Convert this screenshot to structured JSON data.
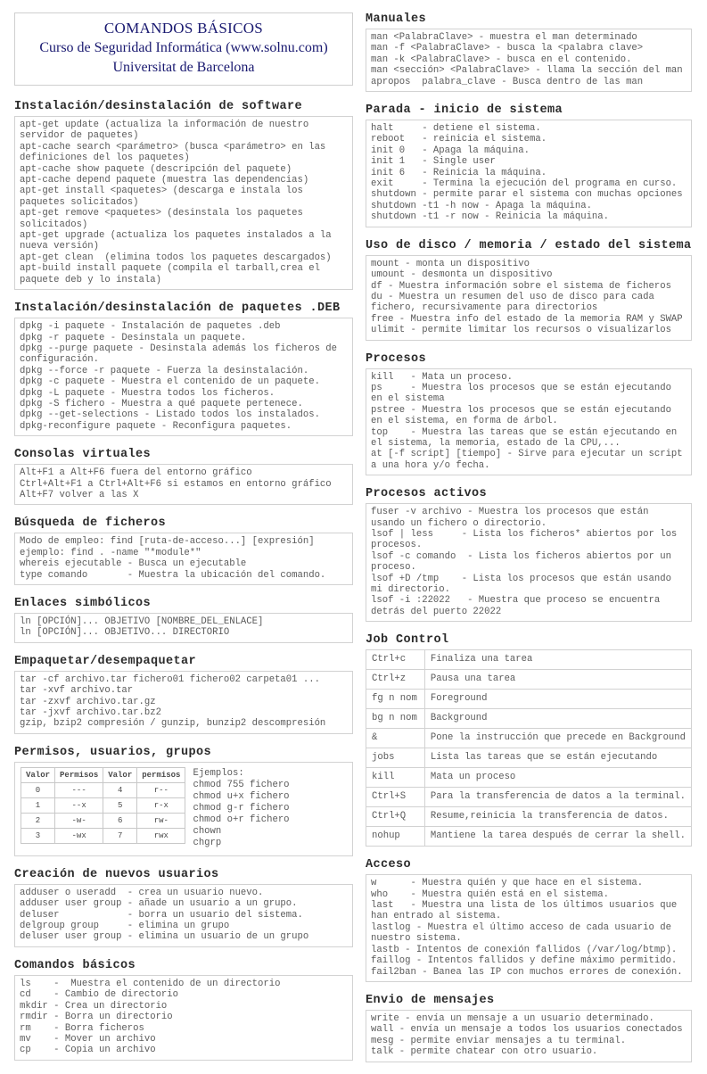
{
  "title": {
    "line1": "COMANDOS BÁSICOS",
    "line2": "Curso de Seguridad Informática (www.solnu.com)",
    "line3": "Universitat de Barcelona",
    "color": "#191970"
  },
  "left_column": [
    {
      "heading": "Instalación/desinstalación de software",
      "lines": [
        "apt-get update (actualiza la información de nuestro servidor de paquetes)",
        "apt-cache search <parámetro> (busca <parámetro> en las definiciones del los paquetes)",
        "apt-cache show paquete (descripción del paquete)",
        "apt-cache depend paquete (muestra las dependencias)",
        "apt-get install <paquetes> (descarga e instala los paquetes solicitados)",
        "apt-get remove <paquetes> (desinstala los paquetes solicitados)",
        "apt-get upgrade (actualiza los paquetes instalados a la nueva versión)",
        "apt-get clean  (elimina todos los paquetes descargados)",
        "apt-build install paquete (compila el tarball,crea el paquete deb y lo instala)"
      ]
    },
    {
      "heading": "Instalación/desinstalación de paquetes .DEB",
      "lines": [
        "dpkg -i paquete - Instalación de paquetes .deb",
        "dpkg -r paquete - Desinstala un paquete.",
        "dpkg --purge paquete - Desinstala además los ficheros de configuración.",
        "dpkg --force -r paquete - Fuerza la desinstalación.",
        "dpkg -c paquete - Muestra el contenido de un paquete.",
        "dpkg -L paquete - Muestra todos los ficheros.",
        "dpkg -S fichero - Muestra a qué paquete pertenece.",
        "dpkg --get-selections - Listado todos los instalados.",
        "dpkg-reconfigure paquete - Reconfigura paquetes."
      ]
    },
    {
      "heading": "Consolas virtuales",
      "lines": [
        "Alt+F1 a Alt+F6 fuera del entorno gráfico",
        "Ctrl+Alt+F1 a Ctrl+Alt+F6 si estamos en entorno gráfico",
        "Alt+F7 volver a las X"
      ]
    },
    {
      "heading": "Búsqueda de ficheros",
      "lines": [
        "Modo de empleo: find [ruta-de-acceso...] [expresión]",
        "ejemplo: find . -name \"*module*\"",
        "whereis ejecutable - Busca un ejecutable",
        "type comando       - Muestra la ubicación del comando."
      ]
    },
    {
      "heading": "Enlaces simbólicos",
      "lines": [
        "ln [OPCIÓN]... OBJETIVO [NOMBRE_DEL_ENLACE]",
        "ln [OPCIÓN]... OBJETIVO... DIRECTORIO"
      ]
    },
    {
      "heading": "Empaquetar/desempaquetar",
      "lines": [
        "tar -cf archivo.tar fichero01 fichero02 carpeta01 ...",
        "tar -xvf archivo.tar",
        "tar -zxvf archivo.tar.gz",
        "tar -jxvf archivo.tar.bz2",
        "gzip, bzip2 compresión / gunzip, bunzip2 descompresión"
      ]
    }
  ],
  "permissions": {
    "heading": "Permisos, usuarios, grupos",
    "table": {
      "headers": [
        "Valor",
        "Permisos",
        "Valor",
        "permisos"
      ],
      "rows": [
        [
          "0",
          "---",
          "4",
          "r--"
        ],
        [
          "1",
          "--x",
          "5",
          "r-x"
        ],
        [
          "2",
          "-w-",
          "6",
          "rw-"
        ],
        [
          "3",
          "-wx",
          "7",
          "rwx"
        ]
      ]
    },
    "examples": [
      "Ejemplos:",
      "chmod 755 fichero",
      "chmod u+x fichero",
      "chmod g-r fichero",
      "chmod o+r fichero",
      "chown",
      "chgrp"
    ]
  },
  "left_column_bottom": [
    {
      "heading": "Creación de nuevos usuarios",
      "lines": [
        "adduser o useradd  - crea un usuario nuevo.",
        "adduser user group - añade un usuario a un grupo.",
        "deluser            - borra un usuario del sistema.",
        "delgroup group     - elimina un grupo",
        "deluser user group - elimina un usuario de un grupo"
      ]
    },
    {
      "heading": "Comandos básicos",
      "lines": [
        "ls    -  Muestra el contenido de un directorio",
        "cd    - Cambio de directorio",
        "mkdir - Crea un directorio",
        "rmdir - Borra un directorio",
        "rm    - Borra ficheros",
        "mv    - Mover un archivo",
        "cp    - Copia un archivo"
      ]
    }
  ],
  "right_column": [
    {
      "heading": "Manuales",
      "lines": [
        "man <PalabraClave> - muestra el man determinado",
        "man -f <PalabraClave> - busca la <palabra clave>",
        "man -k <PalabraClave> - busca en el contenido.",
        "man <sección> <PalabraClave> - llama la sección del man",
        "apropos  palabra_clave - Busca dentro de las man"
      ]
    },
    {
      "heading": "Parada - inicio de sistema",
      "lines": [
        "halt     - detiene el sistema.",
        "reboot   - reinicia el sistema.",
        "init 0   - Apaga la máquina.",
        "init 1   - Single user",
        "init 6   - Reinicia la máquina.",
        "exit     - Termina la ejecución del programa en curso.",
        "shutdown - permite parar el sistema con muchas opciones",
        "shutdown -t1 -h now - Apaga la máquina.",
        "shutdown -t1 -r now - Reinicia la máquina."
      ]
    },
    {
      "heading": "Uso de disco / memoria / estado del sistema",
      "lines": [
        "mount - monta un dispositivo",
        "umount - desmonta un dispositivo",
        "df - Muestra información sobre el sistema de ficheros",
        "du - Muestra un resumen del uso de disco para cada fichero, recursivamente para directorios",
        "free - Muestra info del estado de la memoria RAM y SWAP",
        "ulimit - permite limitar los recursos o visualizarlos"
      ]
    },
    {
      "heading": "Procesos",
      "lines": [
        "kill   - Mata un proceso.",
        "ps     - Muestra los procesos que se están ejecutando en el sistema",
        "pstree - Muestra los procesos que se están ejecutando en el sistema, en forma de árbol.",
        "top    - Muestra las tareas que se están ejecutando en el sistema, la memoria, estado de la CPU,...",
        "at [-f script] [tiempo] - Sirve para ejecutar un script a una hora y/o fecha."
      ]
    },
    {
      "heading": "Procesos activos",
      "lines": [
        "fuser -v archivo - Muestra los procesos que están usando un fichero o directorio.",
        "lsof | less     - Lista los ficheros* abiertos por los procesos.",
        "lsof -c comando  - Lista los ficheros abiertos por un proceso.",
        "lsof +D /tmp    - Lista los procesos que están usando mi directorio.",
        "lsof -i :22022   - Muestra que proceso se encuentra detrás del puerto 22022"
      ]
    }
  ],
  "job_control": {
    "heading": "Job Control",
    "rows": [
      [
        "Ctrl+c",
        "Finaliza una tarea"
      ],
      [
        "Ctrl+z",
        "Pausa una tarea"
      ],
      [
        "fg n nom",
        "Foreground"
      ],
      [
        "bg n nom",
        "Background"
      ],
      [
        "&",
        "Pone la instrucción que precede en Background"
      ],
      [
        "jobs",
        "Lista las tareas que se están ejecutando"
      ],
      [
        "kill",
        "Mata un proceso"
      ],
      [
        "Ctrl+S",
        "Para la transferencia de datos a la terminal."
      ],
      [
        "Ctrl+Q",
        "Resume,reinicia la transferencia de datos."
      ],
      [
        "nohup",
        "Mantiene la tarea después de cerrar la shell."
      ]
    ]
  },
  "right_column_bottom": [
    {
      "heading": "Acceso",
      "lines": [
        "w      - Muestra quién y que hace en el sistema.",
        "who    - Muestra quién está en el sistema.",
        "last   - Muestra una lista de los últimos usuarios que han entrado al sistema.",
        "lastlog - Muestra el último acceso de cada usuario de nuestro sistema.",
        "lastb - Intentos de conexión fallidos (/var/log/btmp).",
        "faillog - Intentos fallidos y define máximo permitido.",
        "fail2ban - Banea las IP con muchos errores de conexión."
      ]
    },
    {
      "heading": "Envio de mensajes",
      "lines": [
        "write - envía un mensaje a un usuario determinado.",
        "wall - envía un mensaje a todos los usuarios conectados",
        "mesg - permite enviar mensajes a tu terminal.",
        "talk - permite chatear con otro usuario."
      ]
    }
  ]
}
